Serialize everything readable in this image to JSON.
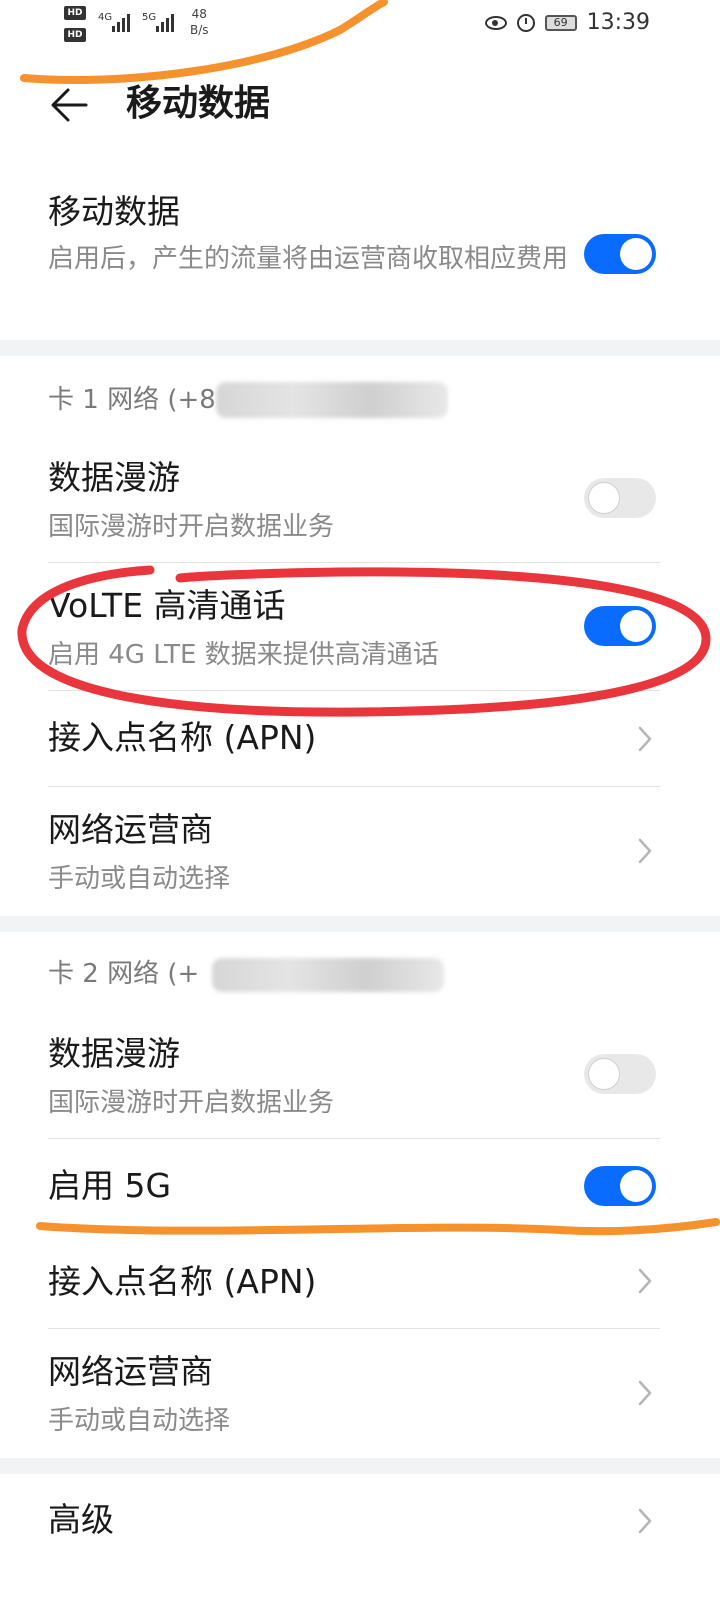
{
  "status_bar": {
    "hd1": "HD 1",
    "hd2": "HD 2",
    "sim1_net": "4G",
    "sim2_net": "5G",
    "speed_value": "48",
    "speed_unit": "B/s",
    "battery": "69",
    "time": "13:39"
  },
  "header": {
    "title": "移动数据"
  },
  "mobile_data": {
    "title": "移动数据",
    "subtitle": "启用后，产生的流量将由运营商收取相应费用",
    "enabled": true
  },
  "sim1": {
    "section_label": "卡 1 网络 (+8",
    "roaming_title": "数据漫游",
    "roaming_subtitle": "国际漫游时开启数据业务",
    "roaming_enabled": false,
    "volte_title": "VoLTE 高清通话",
    "volte_subtitle": "启用 4G LTE 数据来提供高清通话",
    "volte_enabled": true,
    "apn_label": "接入点名称 (APN)",
    "carrier_title": "网络运营商",
    "carrier_subtitle": "手动或自动选择"
  },
  "sim2": {
    "section_label": "卡 2 网络 (+",
    "section_label_end": ")",
    "roaming_title": "数据漫游",
    "roaming_subtitle": "国际漫游时开启数据业务",
    "roaming_enabled": false,
    "enable5g_label": "启用 5G",
    "enable5g_enabled": true,
    "apn_label": "接入点名称 (APN)",
    "carrier_title": "网络运营商",
    "carrier_subtitle": "手动或自动选择"
  },
  "advanced": {
    "label": "高级"
  },
  "colors": {
    "accent": "#0a6cff",
    "annotation_orange": "#f5922e",
    "annotation_red": "#e8363c"
  }
}
